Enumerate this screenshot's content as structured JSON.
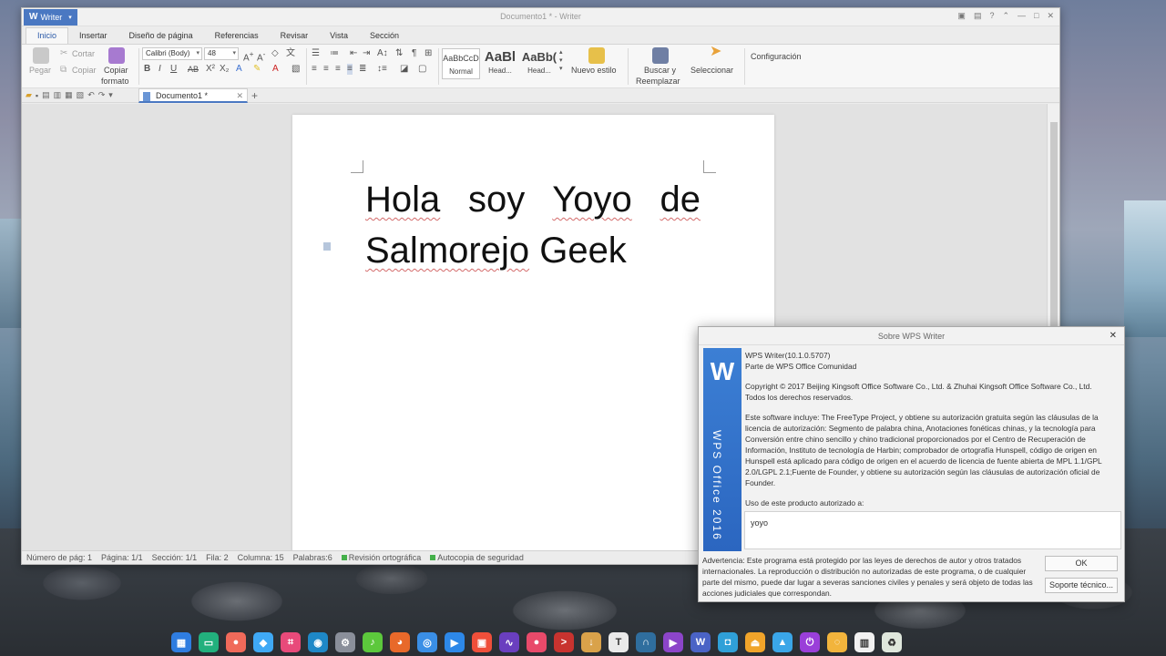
{
  "window": {
    "app_menu": "Writer",
    "title": "Documento1 * - Writer"
  },
  "tabs": [
    "Inicio",
    "Insertar",
    "Diseño de página",
    "Referencias",
    "Revisar",
    "Vista",
    "Sección"
  ],
  "ribbon": {
    "paste": "Pegar",
    "cut": "Cortar",
    "copy": "Copiar",
    "format_painter_l1": "Copiar",
    "format_painter_l2": "formato",
    "font_name": "Calibri (Body)",
    "font_size": "48",
    "styles": [
      {
        "preview": "AaBbCcD",
        "label": "Normal"
      },
      {
        "preview": "AaBl",
        "label": "Head..."
      },
      {
        "preview": "AaBb(",
        "label": "Head..."
      }
    ],
    "new_style": "Nuevo estilo",
    "find_replace_l1": "Buscar y",
    "find_replace_l2": "Reemplazar",
    "select": "Seleccionar",
    "settings": "Configuración"
  },
  "doc_tab": "Documento1 *",
  "document": {
    "line1": [
      "Hola",
      "soy",
      "Yoyo",
      "de"
    ],
    "line2": [
      "Salmorejo",
      "Geek"
    ]
  },
  "status": {
    "page_num": "Número de pág: 1",
    "page": "Página: 1/1",
    "section": "Sección: 1/1",
    "row": "Fila: 2",
    "column": "Columna: 15",
    "words": "Palabras:6",
    "spell": "Revisión ortográfica",
    "backup": "Autocopia de seguridad"
  },
  "about": {
    "title": "Sobre WPS Writer",
    "banner_logo": "W",
    "banner_text": "WPS Office 2016",
    "version": "WPS Writer(10.1.0.5707)",
    "part_of": "Parte de WPS Office Comunidad",
    "copyright": "Copyright © 2017 Beijing Kingsoft Office Software Co., Ltd. & Zhuhai Kingsoft Office Software Co., Ltd.",
    "rights": "Todos los derechos reservados.",
    "includes": "Este software incluye: The FreeType Project, y obtiene su autorización gratuita según las cláusulas de la licencia de autorización: Segmento de palabra china, Anotaciones fonéticas chinas, y la tecnología para Conversión entre chino sencillo y chino tradicional proporcionados por el Centro de Recuperación de Información, Instituto de tecnología de Harbin; comprobador de ortografía Hunspell, código de origen en Hunspell está aplicado para código de origen en el acuerdo de licencia de fuente abierta de MPL 1.1/GPL 2.0/LGPL 2.1;Fuente de Founder, y obtiene su autorización según las cláusulas de autorización oficial de Founder.",
    "licensed_to_label": "Uso de este producto autorizado a:",
    "licensed_to": "yoyo",
    "warning": "Advertencia: Este programa está protegido por las leyes de derechos de autor y otros tratados internacionales. La reproducción o distribución no autorizadas de este programa, o de cualquier parte del mismo, puede dar lugar a severas sanciones civiles y penales y será objeto de todas las acciones judiciales que correspondan.",
    "ok": "OK",
    "support": "Soporte técnico..."
  },
  "dock": [
    {
      "name": "multitask-view-icon",
      "color": "#2f7de0",
      "glyph": "▦"
    },
    {
      "name": "terminal-icon",
      "color": "#22b07d",
      "glyph": "▭"
    },
    {
      "name": "screen-record-icon",
      "color": "#f06a5a",
      "glyph": "●"
    },
    {
      "name": "store-icon",
      "color": "#3fa9f5",
      "glyph": "◆"
    },
    {
      "name": "screenshot-icon",
      "color": "#e84a7a",
      "glyph": "⌗"
    },
    {
      "name": "launcher-icon",
      "color": "#1e88c7",
      "glyph": "◉"
    },
    {
      "name": "settings-icon",
      "color": "#8a8f9a",
      "glyph": "⚙"
    },
    {
      "name": "music-icon",
      "color": "#5cc83c",
      "glyph": "♪"
    },
    {
      "name": "firefox-icon",
      "color": "#e8692a",
      "glyph": "◕"
    },
    {
      "name": "chrome-icon",
      "color": "#3a8fe6",
      "glyph": "◎"
    },
    {
      "name": "video-editor-icon",
      "color": "#2d88e8",
      "glyph": "▶"
    },
    {
      "name": "video-icon",
      "color": "#ef4f3a",
      "glyph": "▣"
    },
    {
      "name": "monitor-icon",
      "color": "#6a3fbf",
      "glyph": "∿"
    },
    {
      "name": "voice-icon",
      "color": "#e84a6a",
      "glyph": "●"
    },
    {
      "name": "console-icon",
      "color": "#c8332f",
      "glyph": ">"
    },
    {
      "name": "download-icon",
      "color": "#d9a24a",
      "glyph": "↓"
    },
    {
      "name": "text-editor-icon",
      "color": "#eaeaea",
      "glyph": "T"
    },
    {
      "name": "headphones-icon",
      "color": "#2f6e9e",
      "glyph": "∩"
    },
    {
      "name": "media-player-icon",
      "color": "#8c45c9",
      "glyph": "▶"
    },
    {
      "name": "wps-writer-icon",
      "color": "#4a63c6",
      "glyph": "W"
    },
    {
      "name": "camera-icon",
      "color": "#2fa0d8",
      "glyph": "◘"
    },
    {
      "name": "eject-icon",
      "color": "#f0a42a",
      "glyph": "⏏"
    },
    {
      "name": "gallery-icon",
      "color": "#3aa6e8",
      "glyph": "▲"
    },
    {
      "name": "power-icon",
      "color": "#9a3fd9",
      "glyph": "⏻"
    },
    {
      "name": "updater-icon",
      "color": "#f2b43c",
      "glyph": "◌"
    },
    {
      "name": "calendar-icon",
      "color": "#f1f1f1",
      "glyph": "▥"
    },
    {
      "name": "trash-icon",
      "color": "#dfe7dc",
      "glyph": "♻"
    }
  ]
}
